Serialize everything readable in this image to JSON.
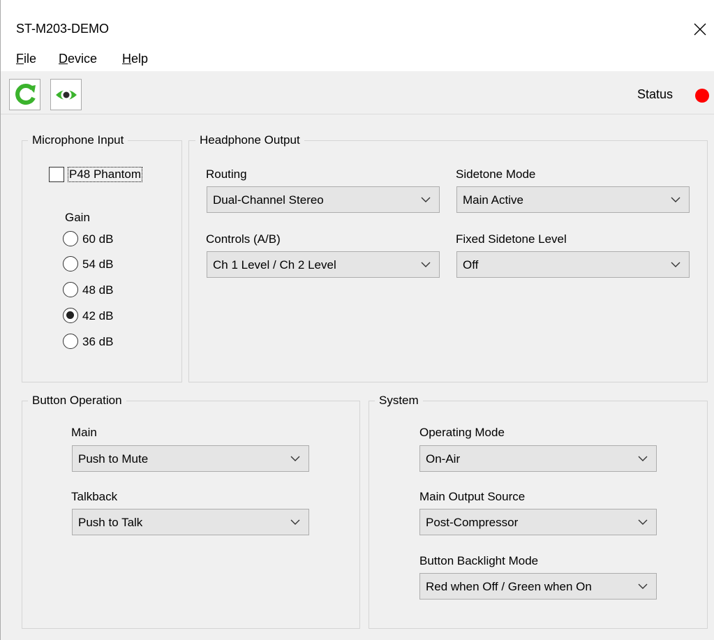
{
  "window": {
    "title": "ST-M203-DEMO"
  },
  "menu": {
    "items": [
      {
        "accel": "F",
        "rest": "ile"
      },
      {
        "accel": "D",
        "rest": "evice"
      },
      {
        "accel": "H",
        "rest": "elp"
      }
    ]
  },
  "toolbar": {
    "status_label": "Status",
    "status_color": "#ff0000",
    "refresh_color": "#3bb32d",
    "monitor_color": "#3bb32d"
  },
  "microphone": {
    "title": "Microphone Input",
    "phantom_label": "P48 Phantom",
    "phantom_checked": false,
    "gain_label": "Gain",
    "gain_options": [
      "60 dB",
      "54 dB",
      "48 dB",
      "42 dB",
      "36 dB"
    ],
    "gain_selected": "42 dB"
  },
  "headphone": {
    "title": "Headphone Output",
    "routing_label": "Routing",
    "routing_value": "Dual-Channel Stereo",
    "controls_label": "Controls (A/B)",
    "controls_value": "Ch 1 Level / Ch 2 Level",
    "sidetone_mode_label": "Sidetone Mode",
    "sidetone_mode_value": "Main Active",
    "fixed_sidetone_label": "Fixed Sidetone Level",
    "fixed_sidetone_value": "Off"
  },
  "button_op": {
    "title": "Button Operation",
    "main_label": "Main",
    "main_value": "Push to Mute",
    "talkback_label": "Talkback",
    "talkback_value": "Push to Talk"
  },
  "system": {
    "title": "System",
    "operating_mode_label": "Operating Mode",
    "operating_mode_value": "On-Air",
    "main_output_label": "Main Output Source",
    "main_output_value": "Post-Compressor",
    "backlight_label": "Button Backlight Mode",
    "backlight_value": "Red when Off / Green when On"
  }
}
